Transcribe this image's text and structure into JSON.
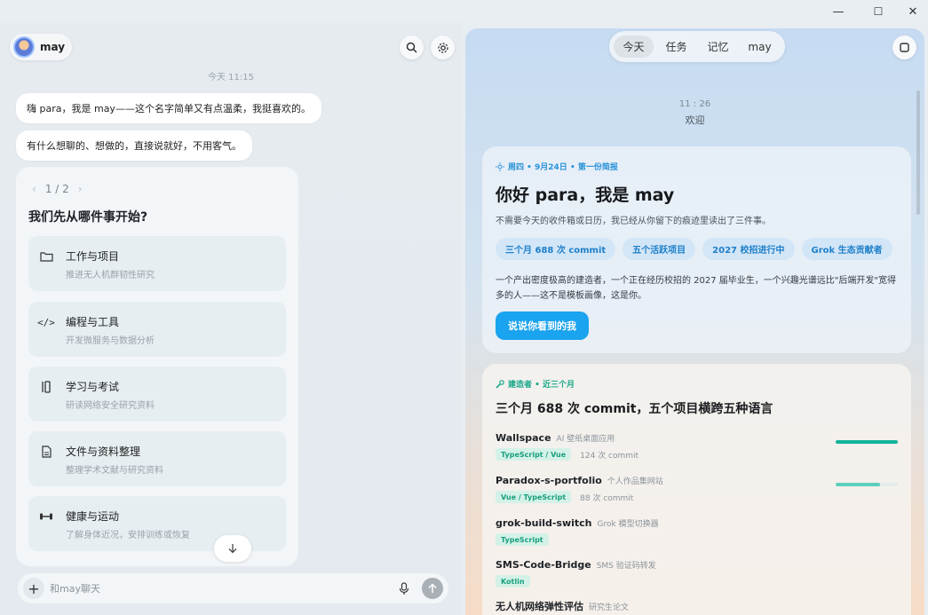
{
  "window": {
    "minimize": "—",
    "maximize": "☐",
    "close": "✕"
  },
  "left": {
    "user_name": "may",
    "timestamp": "今天 11:15",
    "messages": [
      "嗨 para，我是 may——这个名字简单又有点温柔，我挺喜欢的。",
      "有什么想聊的、想做的，直接说就好，不用客气。"
    ],
    "pager": "1 / 2",
    "panel_title": "我们先从哪件事开始?",
    "topics": [
      {
        "icon": "folder-icon",
        "label": "工作与项目",
        "desc": "推进无人机群韧性研究"
      },
      {
        "icon": "code-icon",
        "label": "编程与工具",
        "desc": "开发微服务与数据分析"
      },
      {
        "icon": "book-icon",
        "label": "学习与考试",
        "desc": "研读网络安全研究资料"
      },
      {
        "icon": "document-icon",
        "label": "文件与资料整理",
        "desc": "整理学术文献与研究资料"
      },
      {
        "icon": "dumbbell-icon",
        "label": "健康与运动",
        "desc": "了解身体近况，安排训练或恢复"
      }
    ],
    "input_placeholder": "和may聊天"
  },
  "right": {
    "tabs": [
      "今天",
      "任务",
      "记忆",
      "may"
    ],
    "active_tab": 0,
    "time": "11 : 26",
    "welcome": "欢迎",
    "card1": {
      "tag": "周四 • 9月24日 • 第一份简报",
      "title": "你好 para，我是 may",
      "subtitle": "不需要今天的收件箱或日历，我已经从你留下的痕迹里读出了三件事。",
      "chips": [
        "三个月 688 次 commit",
        "五个活跃项目",
        "2027 校招进行中",
        "Grok 生态贡献者"
      ],
      "body": "一个产出密度极高的建造者，一个正在经历校招的 2027 届毕业生，一个兴趣光谱远比\"后端开发\"宽得多的人——这不是模板画像，这是你。",
      "button": "说说你看到的我"
    },
    "card2": {
      "tag": "建造者 • 近三个月",
      "title": "三个月 688 次 commit，五个项目横跨五种语言",
      "repos": [
        {
          "name": "Wallspace",
          "desc": "AI 壁纸桌面应用",
          "lang": "TypeScript / Vue",
          "commits": "124 次 commit",
          "progress": 1.0
        },
        {
          "name": "Paradox-s-portfolio",
          "desc": "个人作品集网站",
          "lang": "Vue / TypeScript",
          "commits": "88 次 commit",
          "progress": 0.71
        },
        {
          "name": "grok-build-switch",
          "desc": "Grok 模型切换器",
          "lang": "TypeScript",
          "commits": "",
          "progress": null
        },
        {
          "name": "SMS-Code-Bridge",
          "desc": "SMS 验证码转发",
          "lang": "Kotlin",
          "commits": "",
          "progress": null
        },
        {
          "name": "无人机网络弹性评估",
          "desc": "研究生论文",
          "lang": "",
          "commits": "",
          "progress": null
        }
      ]
    }
  },
  "colors": {
    "accent": "#1aa3ef",
    "teal": "#14b39a"
  }
}
